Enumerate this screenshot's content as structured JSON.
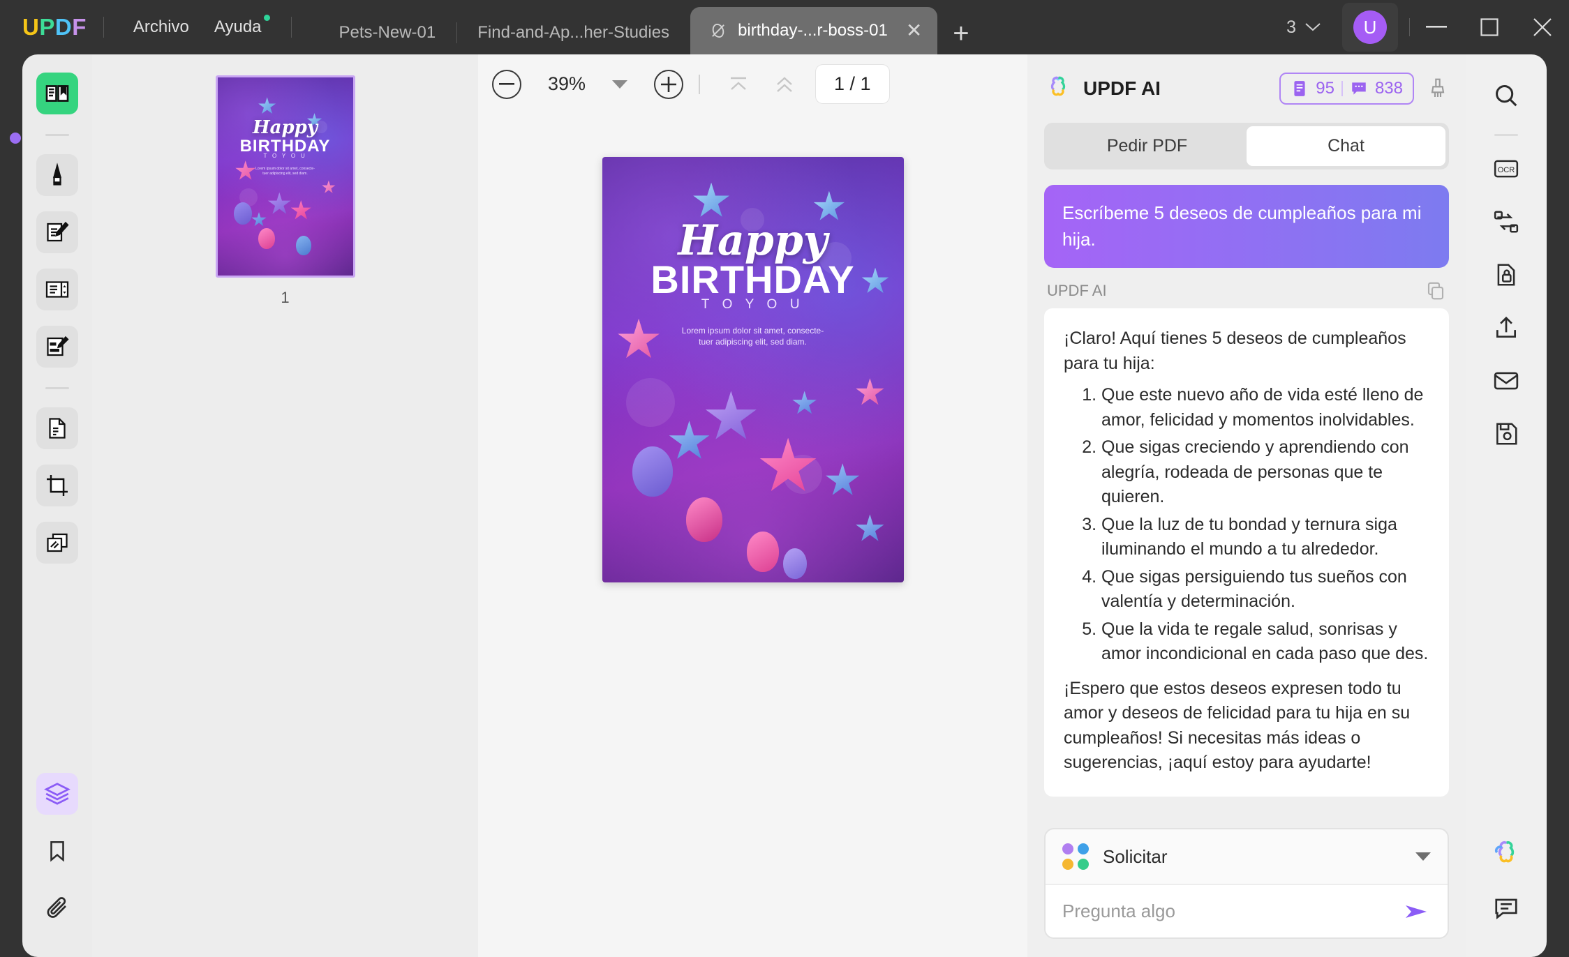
{
  "titlebar": {
    "logo": [
      "U",
      "P",
      "D",
      "F"
    ],
    "menus": [
      {
        "label": "Archivo",
        "dot": false
      },
      {
        "label": "Ayuda",
        "dot": true
      }
    ],
    "tabs": [
      {
        "label": "Pets-New-01",
        "active": false
      },
      {
        "label": "Find-and-Ap...her-Studies",
        "active": false
      },
      {
        "label": "birthday-...r-boss-01",
        "active": true
      }
    ],
    "new_tab_label": "+",
    "tab_count": "3",
    "avatar_initial": "U",
    "window_controls": {
      "minimize": "—",
      "maximize": "□",
      "close": "✕"
    }
  },
  "left_rail": {
    "items": [
      {
        "name": "reader-icon",
        "style": "green"
      },
      {
        "name": "highlighter-icon",
        "style": "grey"
      },
      {
        "name": "edit-pdf-icon",
        "style": "grey"
      },
      {
        "name": "organize-pages-icon",
        "style": "grey"
      },
      {
        "name": "form-fill-icon",
        "style": "grey"
      },
      {
        "name": "convert-pdf-icon",
        "style": "grey"
      },
      {
        "name": "crop-page-icon",
        "style": "grey"
      },
      {
        "name": "compress-icon",
        "style": "grey"
      }
    ],
    "bottom_items": [
      {
        "name": "layers-icon",
        "style": "purple"
      },
      {
        "name": "bookmark-icon",
        "style": "plain"
      },
      {
        "name": "attachment-icon",
        "style": "plain"
      }
    ]
  },
  "thumbnails": {
    "pages": [
      {
        "number": "1"
      }
    ]
  },
  "toolbar": {
    "zoom_out": "−",
    "zoom_value": "39%",
    "zoom_dropdown": "caret-down",
    "zoom_in": "+",
    "first_page": "first-page-icon",
    "prev_page": "prev-page-icon",
    "page_indicator": "1 / 1"
  },
  "document": {
    "happy": "Happy",
    "birthday": "BIRTHDAY",
    "to_you": "T O   Y O U",
    "lorem_line1": "Lorem ipsum dolor sit amet, consecte-",
    "lorem_line2": "tuer adipiscing elit, sed diam."
  },
  "ai_panel": {
    "title": "UPDF AI",
    "credits": {
      "documents": "95",
      "chats": "838"
    },
    "clear_icon": "broom-icon",
    "tabs": [
      {
        "label": "Pedir PDF",
        "active": false
      },
      {
        "label": "Chat",
        "active": true
      }
    ],
    "user_message": "Escríbeme 5 deseos de cumpleaños para mi hija.",
    "ai_label": "UPDF AI",
    "copy_icon": "copy-icon",
    "response": {
      "intro": "¡Claro! Aquí tienes 5 deseos de cumpleaños para tu hija:",
      "items": [
        "Que este nuevo año de vida esté lleno de amor, felicidad y momentos inolvidables.",
        "Que sigas creciendo y aprendiendo con alegría, rodeada de personas que te quieren.",
        "Que la luz de tu bondad y ternura siga iluminando el mundo a tu alrededor.",
        "Que sigas persiguiendo tus sueños con valentía y determinación.",
        "Que la vida te regale salud, sonrisas y amor incondicional en cada paso que des."
      ],
      "closing": "¡Espero que estos deseos expresen todo tu amor y deseos de felicidad para tu hija en su cumpleaños! Si necesitas más ideas o sugerencias, ¡aquí estoy para ayudarte!"
    },
    "composer": {
      "mode_label": "Solicitar",
      "placeholder": "Pregunta algo",
      "input_value": "",
      "send_icon": "send-icon"
    }
  },
  "right_rail": {
    "items": [
      {
        "name": "search-icon"
      },
      {
        "name": "ocr-icon"
      },
      {
        "name": "compare-icon"
      },
      {
        "name": "protect-icon"
      },
      {
        "name": "share-icon"
      },
      {
        "name": "email-icon"
      },
      {
        "name": "save-as-icon"
      }
    ],
    "bottom_items": [
      {
        "name": "updf-ai-icon"
      },
      {
        "name": "comment-icon"
      }
    ]
  },
  "colors": {
    "accent_purple": "#8b5cf6",
    "titlebar_bg": "#333333",
    "panel_bg": "#efefef",
    "green_tool": "#35d47f"
  }
}
